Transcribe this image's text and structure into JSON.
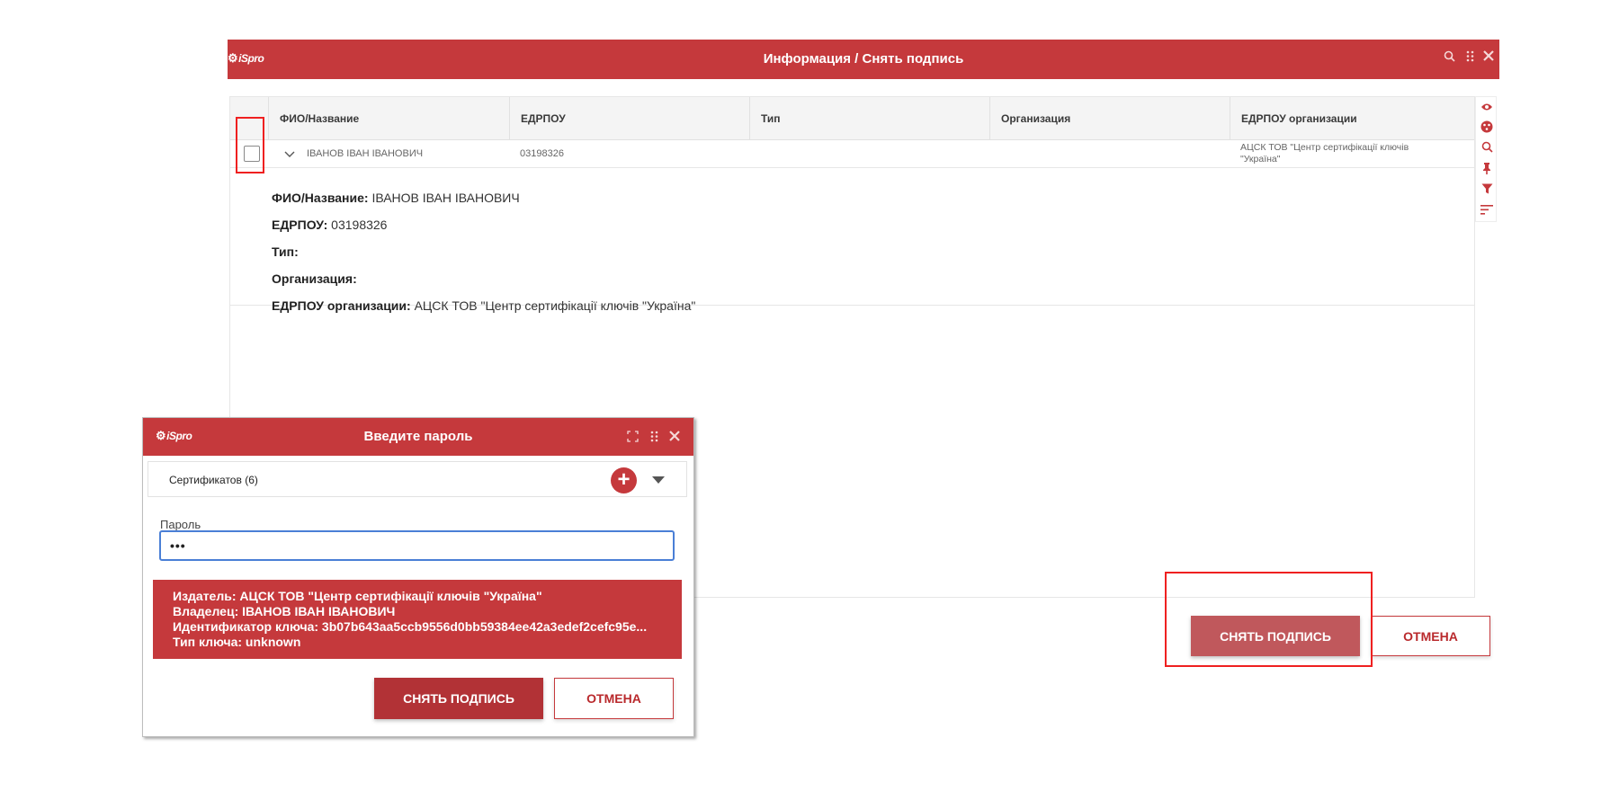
{
  "main": {
    "logo": "iSpro",
    "title": "Информация / Снять подпись",
    "columns": [
      "ФИО/Название",
      "ЕДРПОУ",
      "Тип",
      "Организация",
      "ЕДРПОУ организации"
    ],
    "row": {
      "name": "ІВАНОВ ІВАН ІВАНОВИЧ",
      "edrpou": "03198326",
      "type": "",
      "organization": "",
      "org_edrpou_line1": "АЦСК ТОВ \"Центр сертифікації ключів",
      "org_edrpou_line2": "\"Україна\""
    },
    "detail": {
      "name_label": "ФИО/Название:",
      "name_value": "ІВАНОВ ІВАН ІВАНОВИЧ",
      "edrpou_label": "ЕДРПОУ:",
      "edrpou_value": "03198326",
      "type_label": "Тип:",
      "type_value": "",
      "org_label": "Организация:",
      "org_value": "",
      "org_edrpou_label": "ЕДРПОУ организации:",
      "org_edrpou_value": "АЦСК ТОВ \"Центр сертифікації ключів \"Україна\""
    },
    "remove_button": "СНЯТЬ ПОДПИСЬ",
    "cancel_button": "ОТМЕНА"
  },
  "dialog": {
    "logo": "iSpro",
    "title": "Введите пароль",
    "certificates_label": "Сертификатов (6)",
    "add_symbol": "+",
    "password_label": "Пароль",
    "password_value": "•••",
    "info": {
      "issuer": "Издатель: АЦСК ТОВ \"Центр сертифікації ключів \"Україна\"",
      "owner": "Владелец: ІВАНОВ ІВАН ІВАНОВИЧ",
      "key_id": "Идентификатор ключа: 3b07b643aa5ccb9556d0bb59384ee42a3edef2cefc95e...",
      "key_type": "Тип ключа: unknown"
    },
    "remove_button": "СНЯТЬ ПОДПИСЬ",
    "cancel_button": "ОТМЕНА"
  },
  "icons": {
    "titlebar": [
      "search-icon",
      "drag-grip-icon",
      "close-icon"
    ],
    "side_toolbar": [
      "eye-icon",
      "palette-icon",
      "search-icon",
      "pin-icon",
      "filter-icon",
      "sort-icon"
    ],
    "dialog_titlebar": [
      "expand-icon",
      "drag-grip-icon",
      "close-icon"
    ]
  },
  "colors": {
    "brand_red": "#c5393c",
    "primary_button": "#c0585c",
    "highlight": "#ef2020",
    "input_focus": "#4a7fd6"
  }
}
